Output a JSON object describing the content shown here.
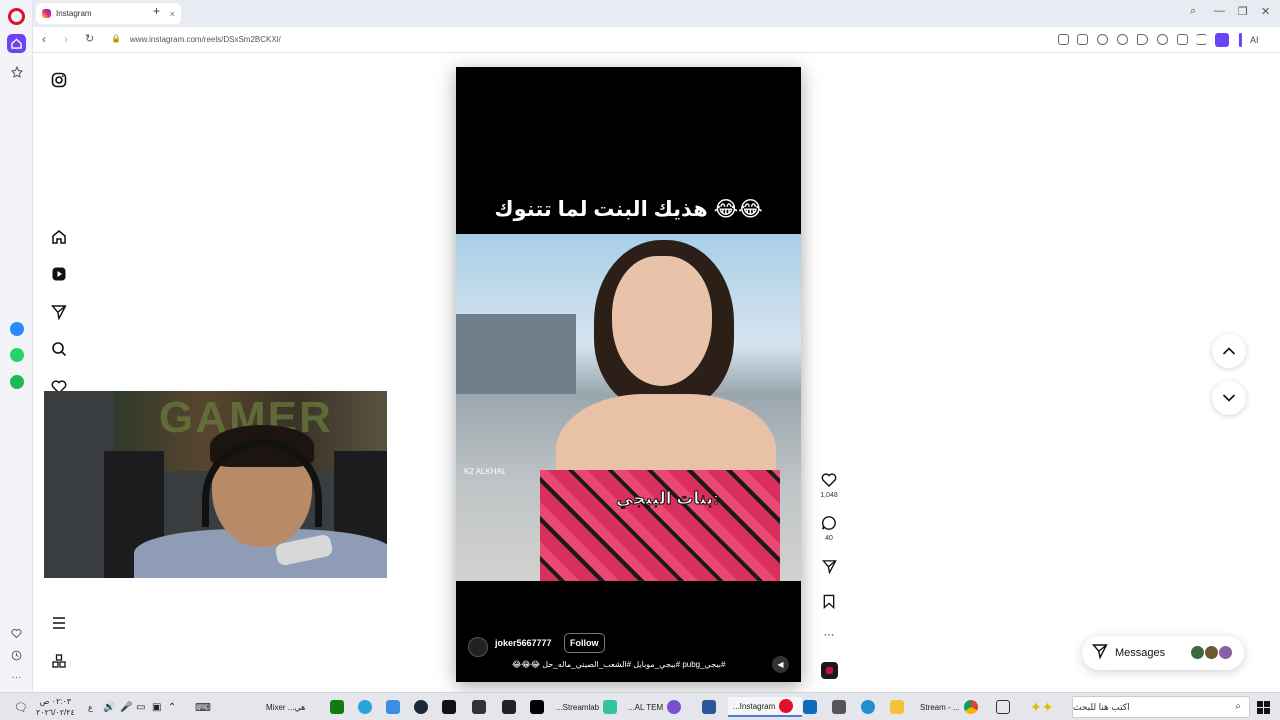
{
  "browser": {
    "tab_title": "Instagram",
    "tab_close": "×",
    "new_tab": "+",
    "url": "www.instagram.com/reels/DSxSm2BCKXl/",
    "ai_label": "AI",
    "window_controls": [
      "⌕",
      "—",
      "❐",
      "✕"
    ]
  },
  "reel": {
    "caption": "هذيك البنت لما تتنوك 😂😂",
    "overlay_text": "بنات الببجي:",
    "watermark": "K2 ALKHAL",
    "username": "joker5667777",
    "follow_label": "Follow",
    "description": "#ببجي_pubg #ببجي_موبايل #الشعب_الصيني_ماله_حل 😂😂😂",
    "likes": "1,048",
    "comments": "40"
  },
  "messages": {
    "label": "Messages"
  },
  "webcam": {
    "banner_text": "GAMER"
  },
  "taskbar": {
    "clock_time": "٠٢:٠٣ ص",
    "clock_date": "٢٠٢٦/٠٢/٢٤",
    "lang": "ع",
    "mixer_label": "Mixer ...هي",
    "streamlab_label": "...Streamlab",
    "al_tem_label": "...AL TEM",
    "instagram_label": "...Instagram",
    "stream_label": "Stream - ...",
    "search_placeholder": "اكتب هنا للبحث"
  },
  "colors": {
    "opera_red": "#e0112b",
    "opera_purple": "#6b44f5",
    "reel_bg": "#000000",
    "messenger": "#2d89ff",
    "whatsapp": "#25d366",
    "spotify": "#1db954"
  }
}
